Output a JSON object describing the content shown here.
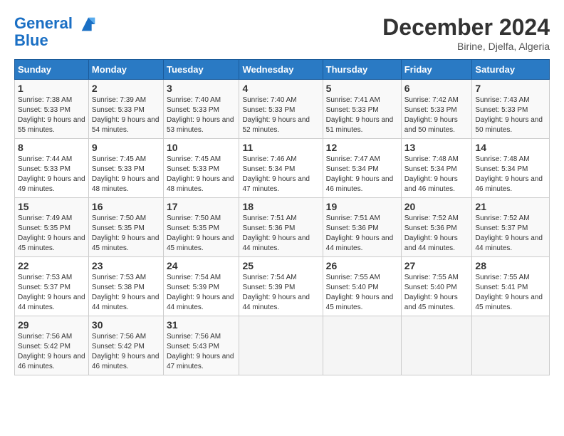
{
  "header": {
    "logo_line1": "General",
    "logo_line2": "Blue",
    "month_title": "December 2024",
    "subtitle": "Birine, Djelfa, Algeria"
  },
  "calendar": {
    "columns": [
      "Sunday",
      "Monday",
      "Tuesday",
      "Wednesday",
      "Thursday",
      "Friday",
      "Saturday"
    ],
    "weeks": [
      [
        {
          "day": "",
          "empty": true
        },
        {
          "day": "",
          "empty": true
        },
        {
          "day": "",
          "empty": true
        },
        {
          "day": "",
          "empty": true
        },
        {
          "day": "",
          "empty": true
        },
        {
          "day": "",
          "empty": true
        },
        {
          "day": "",
          "empty": true
        }
      ],
      [
        {
          "day": "1",
          "sunrise": "7:38 AM",
          "sunset": "5:33 PM",
          "daylight": "9 hours and 55 minutes."
        },
        {
          "day": "2",
          "sunrise": "7:39 AM",
          "sunset": "5:33 PM",
          "daylight": "9 hours and 54 minutes."
        },
        {
          "day": "3",
          "sunrise": "7:40 AM",
          "sunset": "5:33 PM",
          "daylight": "9 hours and 53 minutes."
        },
        {
          "day": "4",
          "sunrise": "7:40 AM",
          "sunset": "5:33 PM",
          "daylight": "9 hours and 52 minutes."
        },
        {
          "day": "5",
          "sunrise": "7:41 AM",
          "sunset": "5:33 PM",
          "daylight": "9 hours and 51 minutes."
        },
        {
          "day": "6",
          "sunrise": "7:42 AM",
          "sunset": "5:33 PM",
          "daylight": "9 hours and 50 minutes."
        },
        {
          "day": "7",
          "sunrise": "7:43 AM",
          "sunset": "5:33 PM",
          "daylight": "9 hours and 50 minutes."
        }
      ],
      [
        {
          "day": "8",
          "sunrise": "7:44 AM",
          "sunset": "5:33 PM",
          "daylight": "9 hours and 49 minutes."
        },
        {
          "day": "9",
          "sunrise": "7:45 AM",
          "sunset": "5:33 PM",
          "daylight": "9 hours and 48 minutes."
        },
        {
          "day": "10",
          "sunrise": "7:45 AM",
          "sunset": "5:33 PM",
          "daylight": "9 hours and 48 minutes."
        },
        {
          "day": "11",
          "sunrise": "7:46 AM",
          "sunset": "5:34 PM",
          "daylight": "9 hours and 47 minutes."
        },
        {
          "day": "12",
          "sunrise": "7:47 AM",
          "sunset": "5:34 PM",
          "daylight": "9 hours and 46 minutes."
        },
        {
          "day": "13",
          "sunrise": "7:48 AM",
          "sunset": "5:34 PM",
          "daylight": "9 hours and 46 minutes."
        },
        {
          "day": "14",
          "sunrise": "7:48 AM",
          "sunset": "5:34 PM",
          "daylight": "9 hours and 46 minutes."
        }
      ],
      [
        {
          "day": "15",
          "sunrise": "7:49 AM",
          "sunset": "5:35 PM",
          "daylight": "9 hours and 45 minutes."
        },
        {
          "day": "16",
          "sunrise": "7:50 AM",
          "sunset": "5:35 PM",
          "daylight": "9 hours and 45 minutes."
        },
        {
          "day": "17",
          "sunrise": "7:50 AM",
          "sunset": "5:35 PM",
          "daylight": "9 hours and 45 minutes."
        },
        {
          "day": "18",
          "sunrise": "7:51 AM",
          "sunset": "5:36 PM",
          "daylight": "9 hours and 44 minutes."
        },
        {
          "day": "19",
          "sunrise": "7:51 AM",
          "sunset": "5:36 PM",
          "daylight": "9 hours and 44 minutes."
        },
        {
          "day": "20",
          "sunrise": "7:52 AM",
          "sunset": "5:36 PM",
          "daylight": "9 hours and 44 minutes."
        },
        {
          "day": "21",
          "sunrise": "7:52 AM",
          "sunset": "5:37 PM",
          "daylight": "9 hours and 44 minutes."
        }
      ],
      [
        {
          "day": "22",
          "sunrise": "7:53 AM",
          "sunset": "5:37 PM",
          "daylight": "9 hours and 44 minutes."
        },
        {
          "day": "23",
          "sunrise": "7:53 AM",
          "sunset": "5:38 PM",
          "daylight": "9 hours and 44 minutes."
        },
        {
          "day": "24",
          "sunrise": "7:54 AM",
          "sunset": "5:39 PM",
          "daylight": "9 hours and 44 minutes."
        },
        {
          "day": "25",
          "sunrise": "7:54 AM",
          "sunset": "5:39 PM",
          "daylight": "9 hours and 44 minutes."
        },
        {
          "day": "26",
          "sunrise": "7:55 AM",
          "sunset": "5:40 PM",
          "daylight": "9 hours and 45 minutes."
        },
        {
          "day": "27",
          "sunrise": "7:55 AM",
          "sunset": "5:40 PM",
          "daylight": "9 hours and 45 minutes."
        },
        {
          "day": "28",
          "sunrise": "7:55 AM",
          "sunset": "5:41 PM",
          "daylight": "9 hours and 45 minutes."
        }
      ],
      [
        {
          "day": "29",
          "sunrise": "7:56 AM",
          "sunset": "5:42 PM",
          "daylight": "9 hours and 46 minutes."
        },
        {
          "day": "30",
          "sunrise": "7:56 AM",
          "sunset": "5:42 PM",
          "daylight": "9 hours and 46 minutes."
        },
        {
          "day": "31",
          "sunrise": "7:56 AM",
          "sunset": "5:43 PM",
          "daylight": "9 hours and 47 minutes."
        },
        {
          "day": "",
          "empty": true
        },
        {
          "day": "",
          "empty": true
        },
        {
          "day": "",
          "empty": true
        },
        {
          "day": "",
          "empty": true
        }
      ]
    ]
  }
}
